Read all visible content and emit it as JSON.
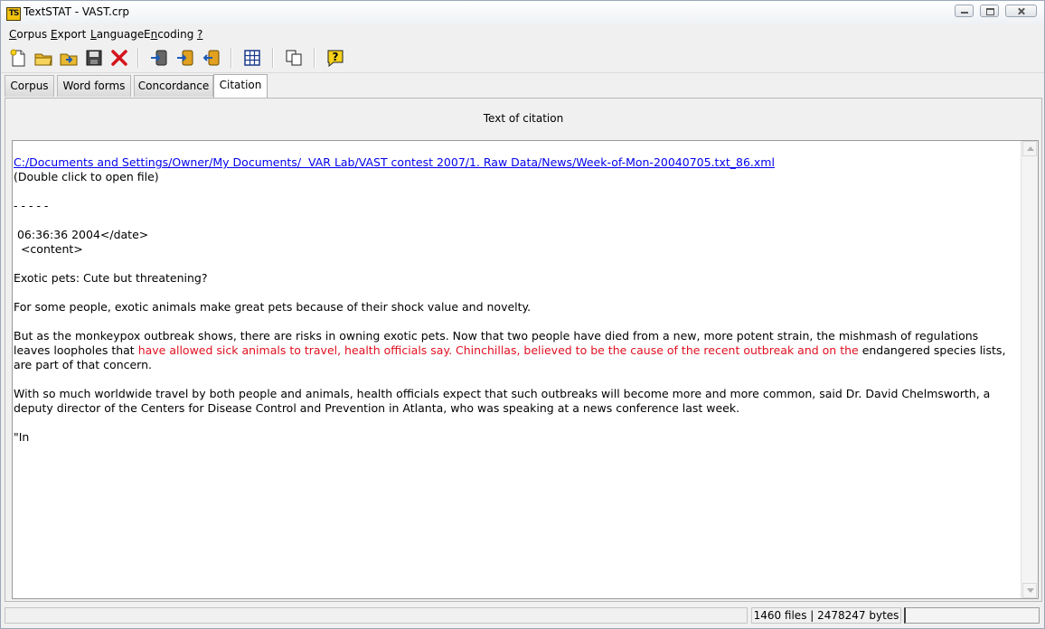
{
  "window": {
    "title": "TextSTAT - VAST.crp",
    "icon_text": "TS"
  },
  "menu": [
    {
      "prefix": "",
      "underline": "C",
      "rest": "orpus"
    },
    {
      "prefix": "",
      "underline": "E",
      "rest": "xport"
    },
    {
      "prefix": "",
      "underline": "L",
      "rest": "anguage"
    },
    {
      "prefix": "E",
      "underline": "n",
      "rest": "coding"
    },
    {
      "prefix": "",
      "underline": "?",
      "rest": ""
    }
  ],
  "toolbar": {
    "icons": [
      "new-corpus-icon",
      "open-corpus-icon",
      "open-folder-icon",
      "save-icon",
      "close-corpus-icon",
      "add-file-icon",
      "add-folder-icon",
      "remove-file-icon",
      "grid-icon",
      "copy-icon",
      "help-icon"
    ]
  },
  "tabs": [
    {
      "label": "Corpus",
      "active": false
    },
    {
      "label": "Word forms",
      "active": false
    },
    {
      "label": "Concordance",
      "active": false
    },
    {
      "label": "Citation",
      "active": true
    }
  ],
  "citation": {
    "caption": "Text of citation",
    "file_link": "C:/Documents and Settings/Owner/My Documents/  VAR Lab/VAST contest 2007/1. Raw Data/News/Week-of-Mon-20040705.txt_86.xml",
    "open_hint": "(Double click to open file)",
    "separator": "- - - - -",
    "date_line": " 06:36:36 2004</date>",
    "content_tag": "  <content>",
    "headline": "Exotic pets: Cute but threatening?",
    "para1": "For some people, exotic animals make great pets because of their shock value and novelty.",
    "para2_before": "But as the monkeypox outbreak shows, there are risks in owning exotic pets. Now that two people have died from a new, more potent strain, the mishmash of regulations leaves loopholes that ",
    "para2_highlight": "have allowed sick animals to travel, health officials say. Chinchillas, believed to be the cause of the recent outbreak and on the",
    "para2_after": " endangered species lists, are part of that concern.",
    "para3": "With so much worldwide travel by both people and animals, health officials expect that such outbreaks will become more and more common, said Dr. David Chelmsworth, a deputy director of the Centers for Disease Control and Prevention in Atlanta, who was speaking at a news conference last week.",
    "trailing": "\"In"
  },
  "status": {
    "files": "1460 files | 2478247 bytes"
  },
  "colors": {
    "highlight": "#e01020",
    "link": "#0000ee"
  }
}
